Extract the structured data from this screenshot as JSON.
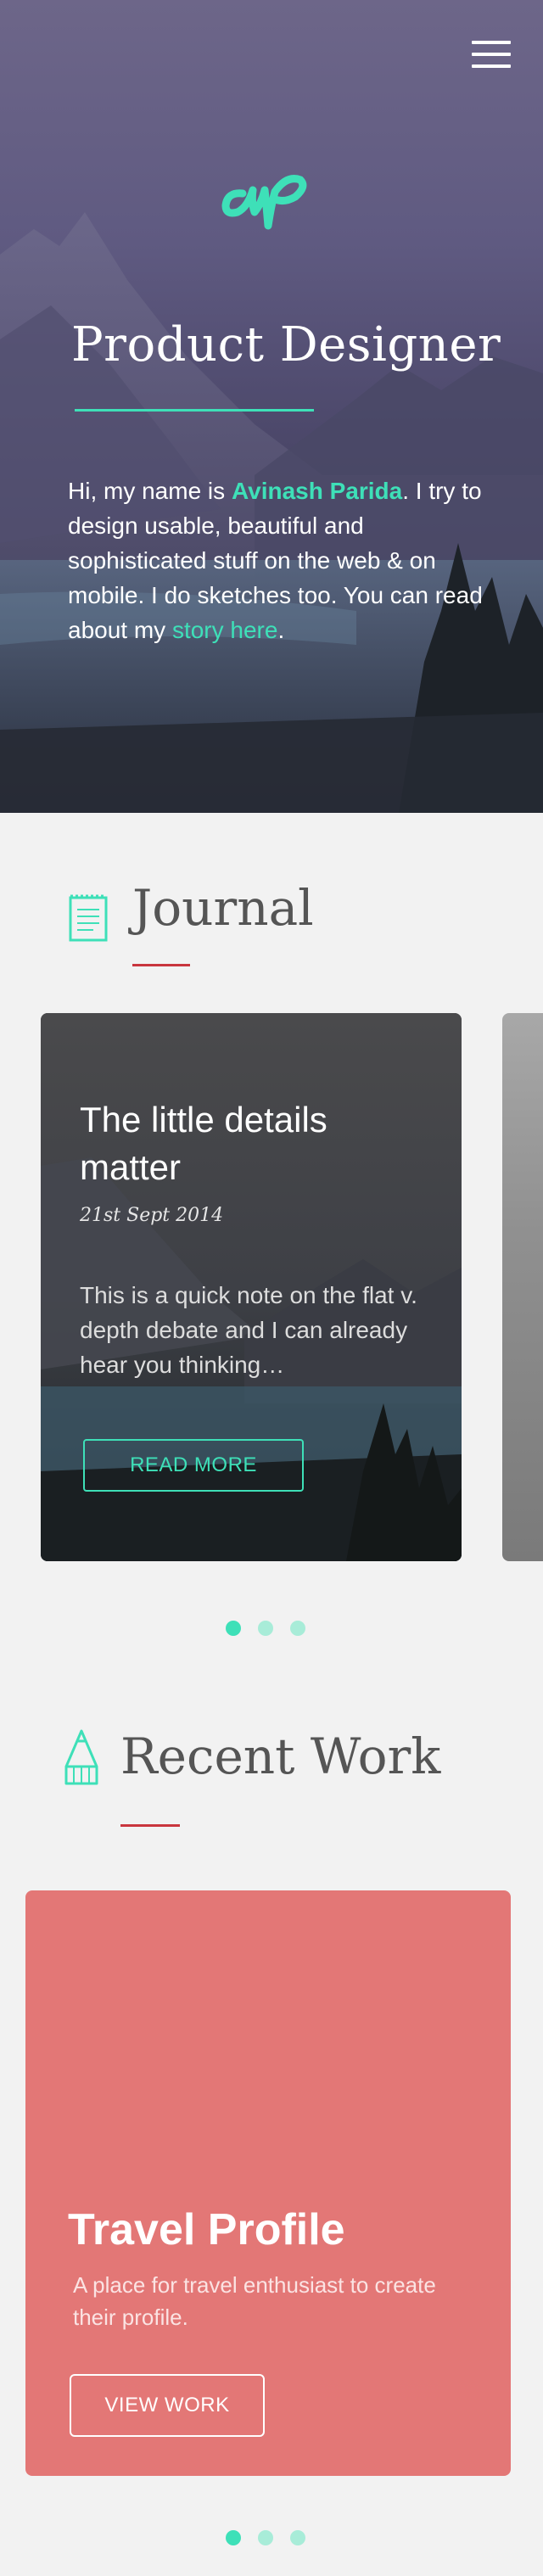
{
  "colors": {
    "accent": "#3ee0b8",
    "divider": "#c9363e",
    "work_card": "#e37776"
  },
  "header": {
    "menu_icon": "hamburger-menu-icon",
    "logo_icon": "ap-monogram-logo"
  },
  "hero": {
    "title": "Product Designer",
    "intro_before": "Hi, my name is ",
    "name": "Avinash Parida",
    "intro_middle": ". I try to design usable, beautiful and sophisticated stuff on the web & on mobile. I do sketches too. You can read about my ",
    "story_link": "story here",
    "intro_after": "."
  },
  "journal": {
    "title": "Journal",
    "icon": "notepad-icon",
    "post": {
      "title": "The little details matter",
      "date": "21st Sept 2014",
      "excerpt": "This is a quick note on the flat v. depth debate and I can already hear you thinking…",
      "button": "READ MORE"
    },
    "slides": 3,
    "active_slide": 1
  },
  "recent_work": {
    "title": "Recent Work",
    "icon": "pencil-icon",
    "project": {
      "title": "Travel Profile",
      "description": "A place for travel enthusiast to create their profile.",
      "button": "VIEW WORK"
    },
    "slides": 3,
    "active_slide": 1
  }
}
